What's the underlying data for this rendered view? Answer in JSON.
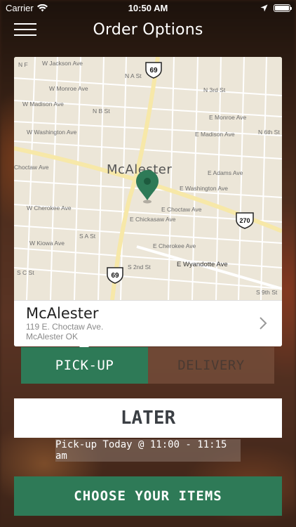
{
  "status_bar": {
    "carrier": "Carrier",
    "time": "10:50 AM"
  },
  "nav": {
    "title": "Order Options",
    "menu_icon": "hamburger-menu-icon"
  },
  "map": {
    "city_label": "McAlester",
    "streets": [
      "W Jackson Ave",
      "W Monroe Ave",
      "W Madison Ave",
      "W Washington Ave",
      "W Cherokee Ave",
      "W Kiowa Ave",
      "E Monroe Ave",
      "E Madison Ave",
      "E Adams Ave",
      "E Washington Ave",
      "E Choctaw Ave",
      "E Chickasaw Ave",
      "E Cherokee Ave",
      "E Wyandotte Ave",
      "N B St",
      "S A St",
      "S C St",
      "S 2nd St",
      "S 9th St",
      "N 3rd St",
      "N 6th St",
      "N A St",
      "N F",
      "Choctaw Ave",
      "Adams Ave"
    ],
    "route_shields": [
      "69",
      "69",
      "270"
    ],
    "pin_color": "#2e7a57"
  },
  "location": {
    "name": "McAlester",
    "address_line1": "119 E. Choctaw Ave.",
    "address_line2": "McAlester OK"
  },
  "order_type": {
    "pickup_label": "PICK-UP",
    "delivery_label": "DELIVERY",
    "selected": "PICK-UP"
  },
  "timing": {
    "later_label": "LATER",
    "pickup_time_text": "Pick-up Today @ 11:00 - 11:15 am"
  },
  "actions": {
    "choose_items_label": "CHOOSE YOUR ITEMS"
  },
  "colors": {
    "accent_green": "#2e7a57"
  }
}
